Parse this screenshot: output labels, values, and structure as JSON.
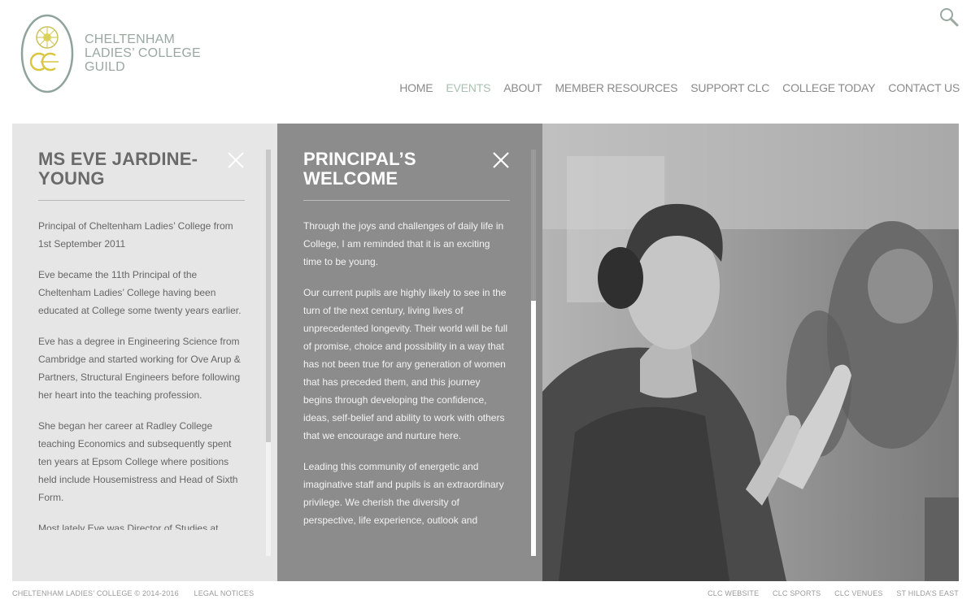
{
  "logo": {
    "line1": "CHELTENHAM",
    "line2": "LADIES’ COLLEGE",
    "line3": "GUILD",
    "color": "#9aa8a0"
  },
  "header": {
    "search_icon": "search-icon",
    "nav": [
      {
        "label": "HOME",
        "active": false
      },
      {
        "label": "EVENTS",
        "active": true
      },
      {
        "label": "ABOUT",
        "active": false
      },
      {
        "label": "MEMBER RESOURCES",
        "active": false
      },
      {
        "label": "SUPPORT CLC",
        "active": false
      },
      {
        "label": "COLLEGE TODAY",
        "active": false
      },
      {
        "label": "CONTACT US",
        "active": false
      }
    ],
    "active_color": "#a9c0b0"
  },
  "panels": {
    "profile": {
      "title": "MS EVE JARDINE-YOUNG",
      "paragraphs": [
        "Principal of Cheltenham Ladies’ College from 1st September 2011",
        "Eve became the 11th Principal of the Cheltenham Ladies’ College having been educated at College some twenty years earlier.",
        "Eve has a degree in Engineering Science from Cambridge and started working for Ove Arup & Partners, Structural Engineers before following her heart into the teaching profession.",
        "She began her career at Radley College teaching Economics and subsequently spent ten years at Epsom College where positions held include Housemistress and Head of Sixth Form.",
        "Most lately Eve was Director of Studies at"
      ]
    },
    "welcome": {
      "title": "PRINCIPAL’S WELCOME",
      "paragraphs": [
        "Through the joys and challenges of daily life in College, I am reminded that it is an exciting time to be young.",
        "Our current pupils are highly likely to see in the turn of the next century, living lives of unprecedented longevity. Their world will be full of promise, choice and possibility in a way that has not been true for any generation of women that has preceded them, and this journey begins through developing the confidence, ideas, self-belief and ability to work with others that we encourage and nurture here.",
        "Leading this community of energetic and imaginative staff and pupils is an extraordinary privilege. We cherish the diversity of perspective, life experience, outlook and cultural background that are the essential"
      ]
    }
  },
  "footer": {
    "copyright": "CHELTENHAM LADIES’ COLLEGE © 2014-2016",
    "legal": "LEGAL NOTICES",
    "links": [
      "CLC WEBSITE",
      "CLC SPORTS",
      "CLC VENUES",
      "ST HILDA’S EAST"
    ]
  }
}
